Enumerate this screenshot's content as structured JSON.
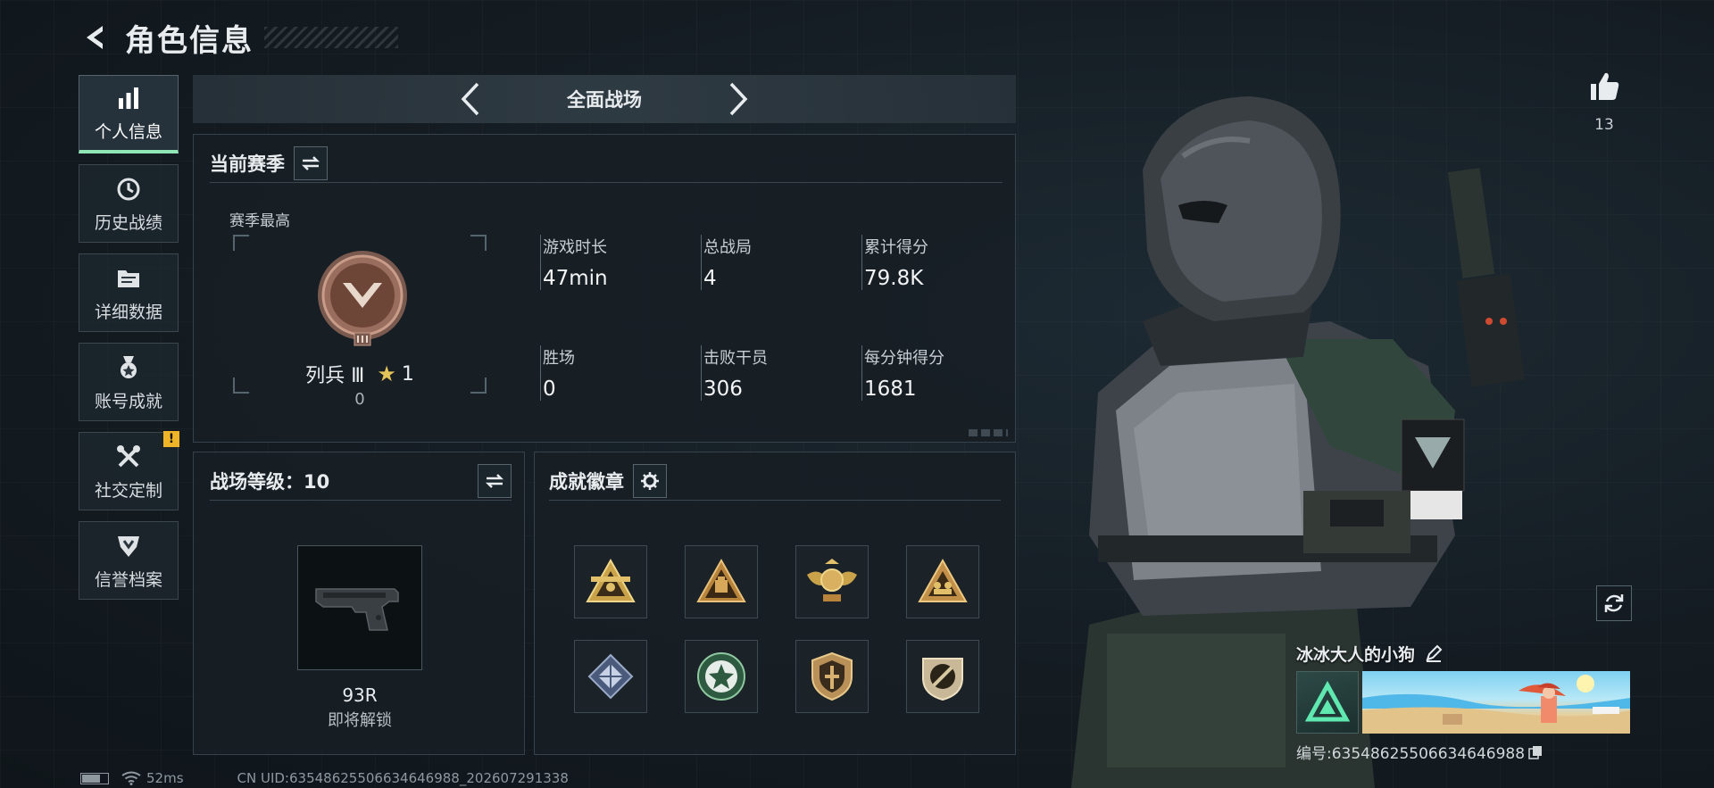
{
  "header": {
    "title": "角色信息"
  },
  "sidebar": {
    "items": [
      {
        "label": "个人信息",
        "icon": "bar-chart-icon",
        "active": true
      },
      {
        "label": "历史战绩",
        "icon": "history-clock-icon"
      },
      {
        "label": "详细数据",
        "icon": "folder-data-icon"
      },
      {
        "label": "账号成就",
        "icon": "medal-icon"
      },
      {
        "label": "社交定制",
        "icon": "tools-icon",
        "badge": "!"
      },
      {
        "label": "信誉档案",
        "icon": "shield-credit-icon"
      }
    ]
  },
  "mode_selector": {
    "label": "全面战场"
  },
  "season": {
    "title": "当前赛季",
    "best_label": "赛季最高",
    "rank": {
      "name": "列兵 Ⅲ",
      "stars": "1",
      "points": "0"
    },
    "stats": [
      {
        "key": "游戏时长",
        "value": "47min"
      },
      {
        "key": "总战局",
        "value": "4"
      },
      {
        "key": "累计得分",
        "value": "79.8K"
      },
      {
        "key": "胜场",
        "value": "0"
      },
      {
        "key": "击败干员",
        "value": "306"
      },
      {
        "key": "每分钟得分",
        "value": "1681"
      }
    ]
  },
  "battle_level": {
    "title": "战场等级：10",
    "weapon": {
      "name": "93R",
      "status": "即将解锁"
    }
  },
  "achievements": {
    "title": "成就徽章",
    "badges": [
      "triangle-team-badge-icon",
      "triangle-bag-badge-icon",
      "winged-crest-badge-icon",
      "triangle-squad-badge-icon",
      "cube-badge-icon",
      "star-seal-badge-icon",
      "shield-emblem-badge-icon",
      "round-shield-badge-icon"
    ]
  },
  "social": {
    "likes": "13"
  },
  "player": {
    "name": "冰冰大人的小狗",
    "id_text": "编号:6354862550663464698​8"
  },
  "footer": {
    "ping": "52ms",
    "uid": "CN UID:63548625506634646988_202607291338"
  },
  "colors": {
    "accent": "#8fe6b4",
    "warning": "#f0b428",
    "star": "#e5c45a"
  }
}
